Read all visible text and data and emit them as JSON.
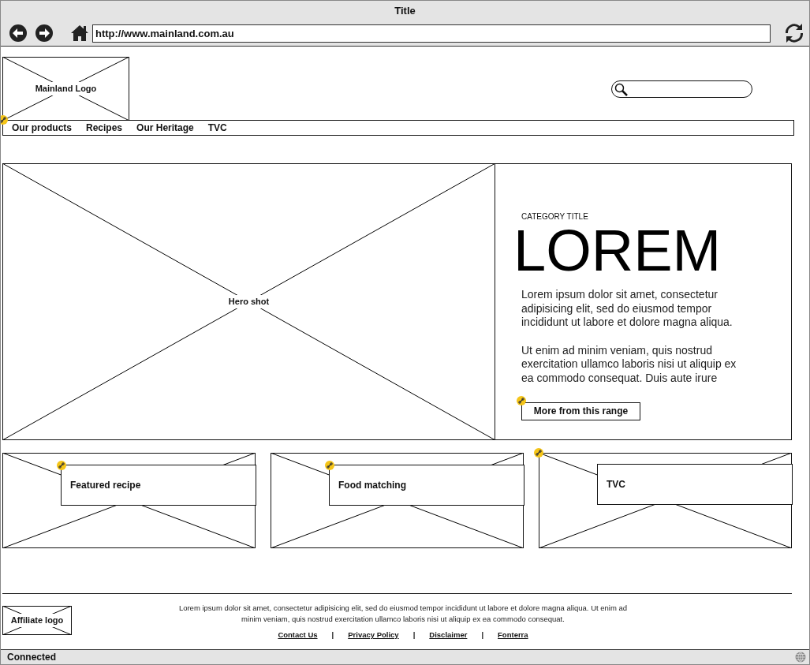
{
  "window": {
    "title": "Title"
  },
  "address_bar": {
    "value": "http://www.mainland.com.au"
  },
  "header": {
    "logo": "Mainland Logo"
  },
  "nav": [
    {
      "label": "Our products"
    },
    {
      "label": "Recipes"
    },
    {
      "label": "Our Heritage"
    },
    {
      "label": "TVC"
    }
  ],
  "hero": {
    "image_label": "Hero shot",
    "category": "CATEGORY TITLE",
    "heading": "LOREM",
    "paragraphs": [
      "Lorem ipsum dolor sit amet, consectetur adipisicing elit, sed do eiusmod tempor incididunt ut labore et dolore magna aliqua.",
      "Ut enim ad minim veniam, quis nostrud exercitation ullamco laboris nisi ut aliquip ex ea commodo consequat. Duis aute irure"
    ],
    "button": "More from this range"
  },
  "cards": [
    {
      "label": "Featured recipe"
    },
    {
      "label": "Food matching"
    },
    {
      "label": "TVC"
    }
  ],
  "footer": {
    "affiliate_logo": "Affiliate logo",
    "text": "Lorem ipsum dolor sit amet, consectetur adipisicing elit, sed do eiusmod tempor incididunt ut labore et dolore magna aliqua. Ut enim ad minim veniam, quis nostrud exercitation ullamco laboris nisi ut aliquip ex ea commodo consequat.",
    "links": [
      {
        "label": "Contact Us"
      },
      {
        "label": "Privacy Policy"
      },
      {
        "label": "Disclaimer"
      },
      {
        "label": "Fonterra"
      }
    ],
    "separators": [
      "|",
      "|",
      "|"
    ]
  },
  "status_bar": {
    "text": "Connected"
  }
}
